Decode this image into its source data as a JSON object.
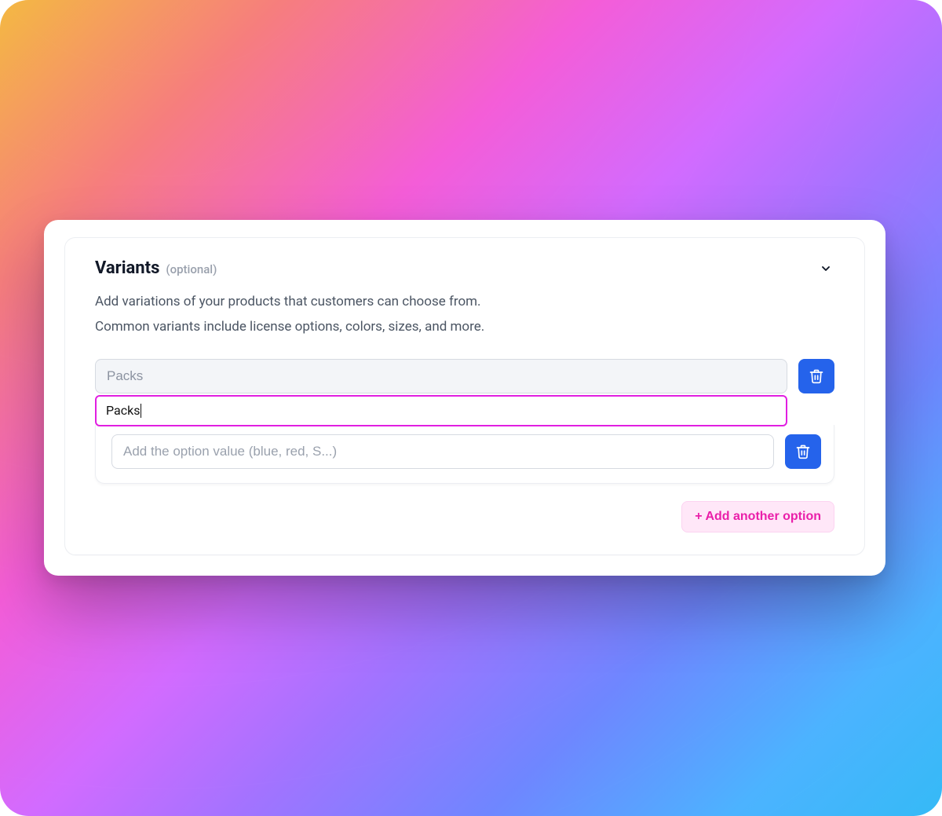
{
  "variants": {
    "title": "Variants",
    "optional_label": "(optional)",
    "description_line1": "Add variations of your products that customers can choose from.",
    "description_line2": "Common variants include license options, colors, sizes, and more.",
    "option_name_display": "Packs",
    "option_name_editing": "Packs",
    "option_value_placeholder": "Add the option value (blue, red, S...)",
    "option_value": "",
    "add_button_label": "+ Add another option"
  },
  "icons": {
    "chevron": "chevron-down-icon",
    "trash": "trash-icon"
  },
  "colors": {
    "accent_pink": "#ea1fa9",
    "focus_magenta": "#e11fe1",
    "primary_blue": "#2563eb"
  }
}
